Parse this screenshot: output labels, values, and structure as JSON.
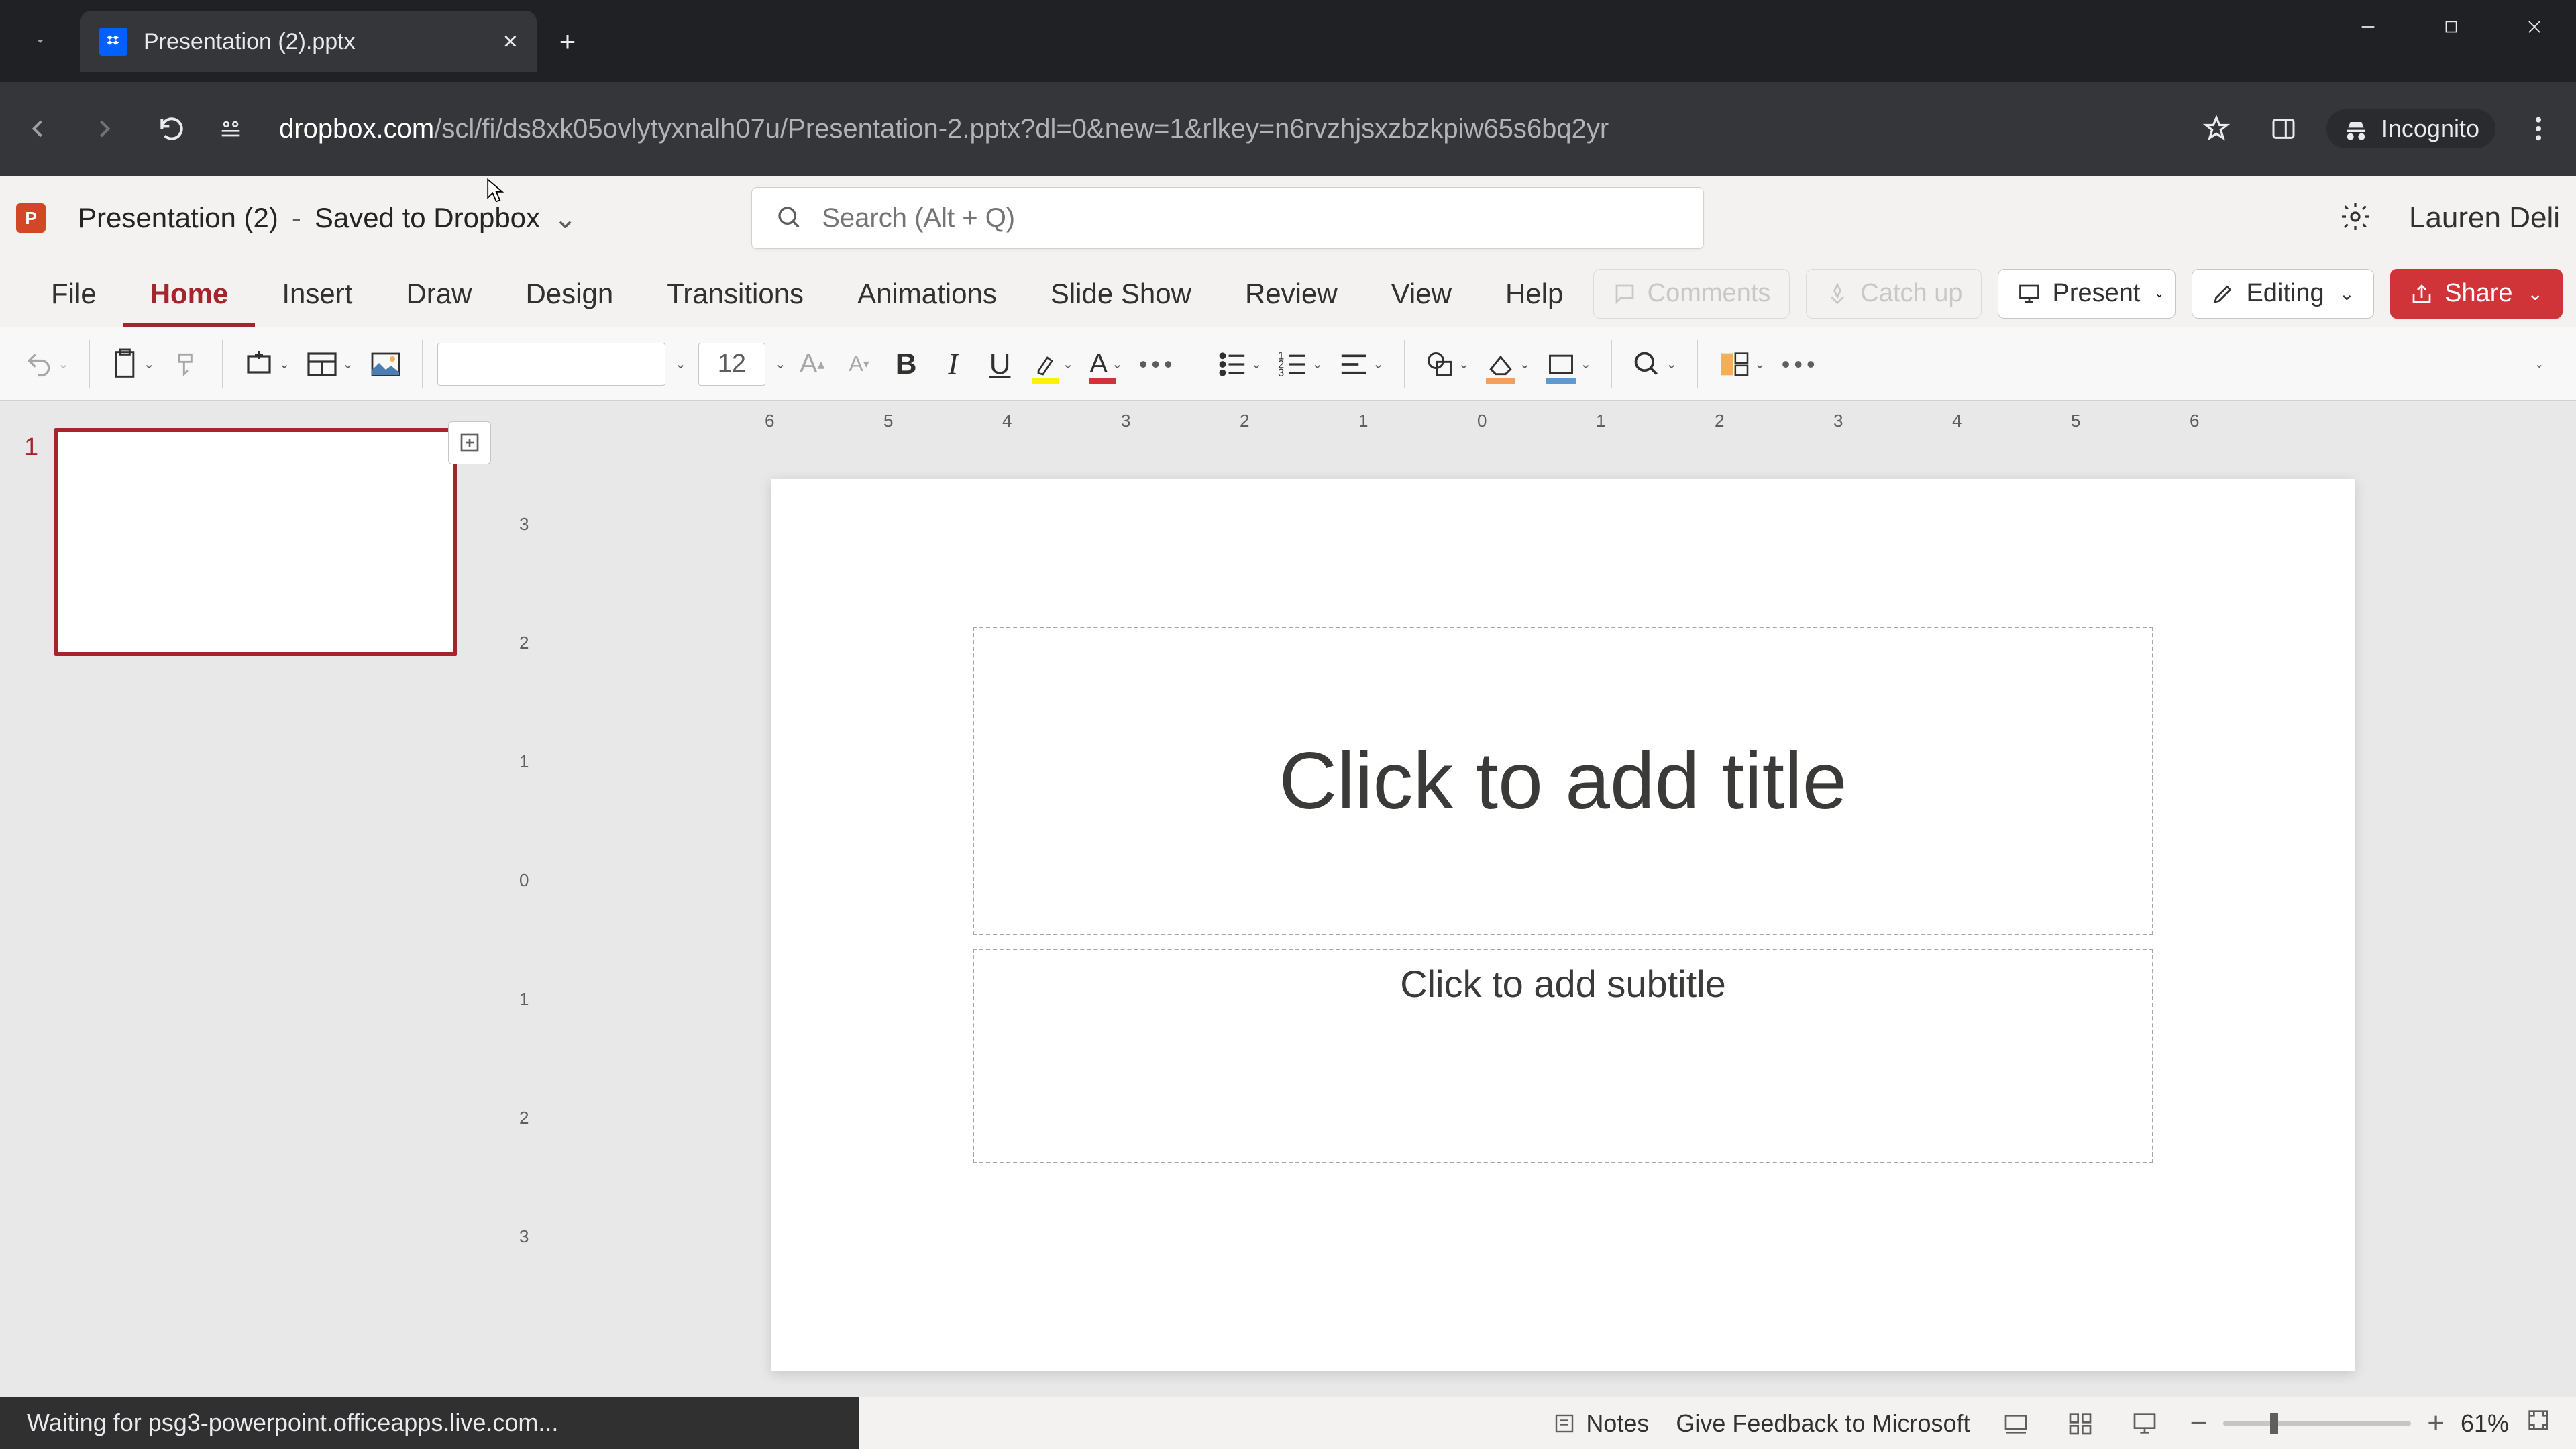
{
  "browser": {
    "tab_title": "Presentation (2).pptx",
    "url_domain": "dropbox.com",
    "url_path": "/scl/fi/ds8xk05ovlytyxnalh07u/Presentation-2.pptx?dl=0&new=1&rlkey=n6rvzhjsxzbzkpiw65s6bq2yr",
    "incognito_label": "Incognito"
  },
  "app": {
    "icon_letter": "P",
    "doc_name": "Presentation (2)",
    "save_state": "Saved to Dropbox",
    "search_placeholder": "Search (Alt + Q)",
    "user": "Lauren Deli"
  },
  "ribbon": {
    "tabs": [
      "File",
      "Home",
      "Insert",
      "Draw",
      "Design",
      "Transitions",
      "Animations",
      "Slide Show",
      "Review",
      "View",
      "Help"
    ],
    "active": "Home",
    "comments": "Comments",
    "catchup": "Catch up",
    "present": "Present",
    "editing": "Editing",
    "share": "Share"
  },
  "toolbar": {
    "font_size": "12"
  },
  "thumbs": {
    "slide_number": "1"
  },
  "slide": {
    "title_placeholder": "Click to add title",
    "subtitle_placeholder": "Click to add subtitle"
  },
  "ruler_h": [
    "6",
    "5",
    "4",
    "3",
    "2",
    "1",
    "0",
    "1",
    "2",
    "3",
    "4",
    "5",
    "6"
  ],
  "ruler_v": [
    "3",
    "2",
    "1",
    "0",
    "1",
    "2",
    "3"
  ],
  "status": {
    "loading": "Waiting for psg3-powerpoint.officeapps.live.com...",
    "notes": "Notes",
    "feedback": "Give Feedback to Microsoft",
    "zoom": "61%"
  }
}
